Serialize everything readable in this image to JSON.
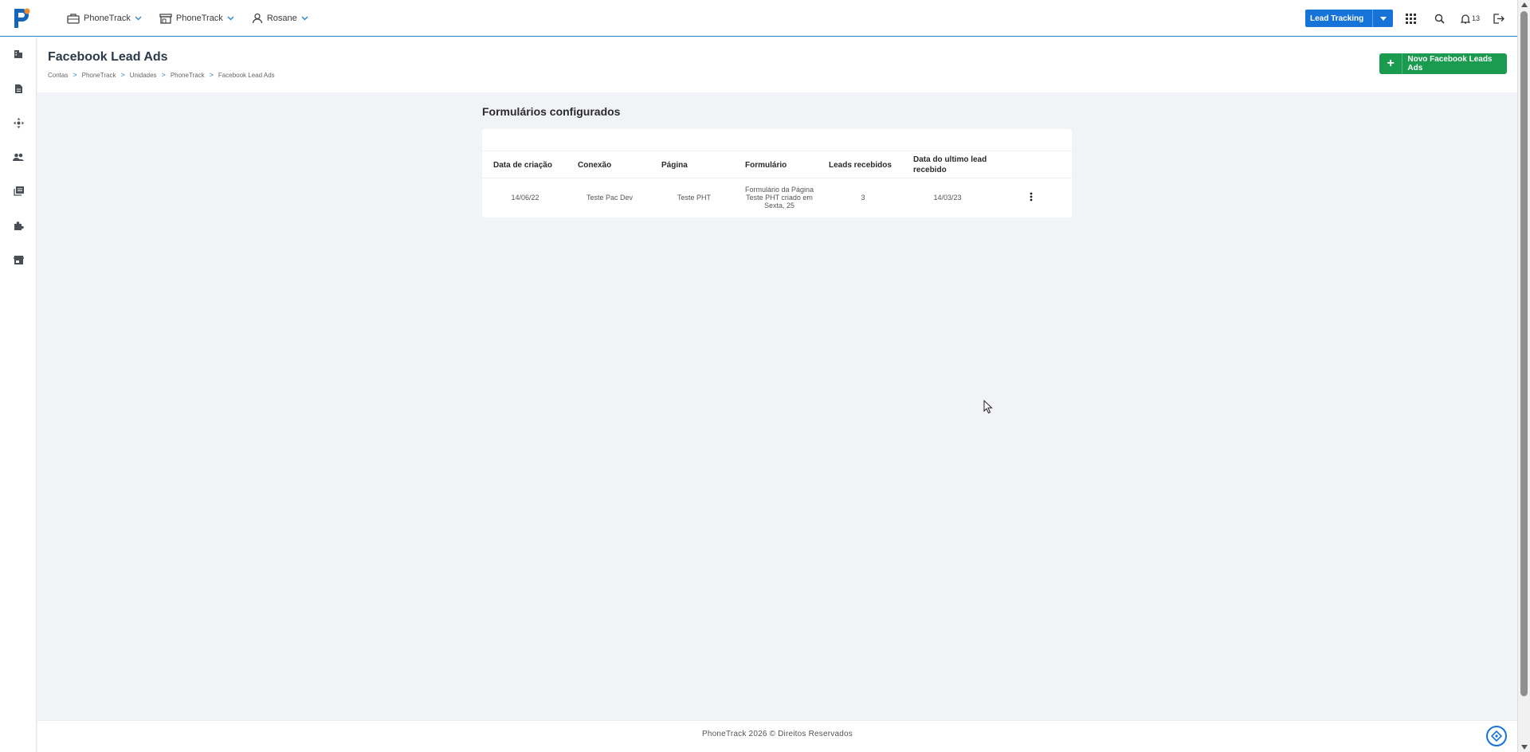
{
  "topbar": {
    "menus": [
      {
        "label": "PhoneTrack",
        "icon": "briefcase-icon"
      },
      {
        "label": "PhoneTrack",
        "icon": "store-icon"
      },
      {
        "label": "Rosane",
        "icon": "user-icon"
      }
    ],
    "lead_button_label": "Lead Tracking",
    "notifications_count": "13"
  },
  "page": {
    "title": "Facebook Lead Ads",
    "breadcrumb": [
      "Contas",
      "PhoneTrack",
      "Unidades",
      "PhoneTrack",
      "Facebook Lead Ads"
    ],
    "breadcrumb_separator": ">",
    "new_button_label": "Novo Facebook Leads Ads",
    "new_button_plus": "+"
  },
  "section": {
    "title": "Formulários configurados"
  },
  "table": {
    "headers": [
      "Data de criação",
      "Conexão",
      "Página",
      "Formulário",
      "Leads recebidos",
      "Data do ultimo lead recebido"
    ],
    "rows": [
      {
        "created": "14/06/22",
        "connection": "Teste Pac Dev",
        "page": "Teste PHT",
        "form": "Formulário da Página Teste PHT criado em Sexta, 25",
        "leads": "3",
        "last_lead": "14/03/23"
      }
    ]
  },
  "footer": {
    "text": "PhoneTrack 2026 © Direitos Reservados"
  },
  "colors": {
    "brand_blue": "#1673d8",
    "green": "#1a9b4f",
    "accent_line": "#2f86c6"
  }
}
